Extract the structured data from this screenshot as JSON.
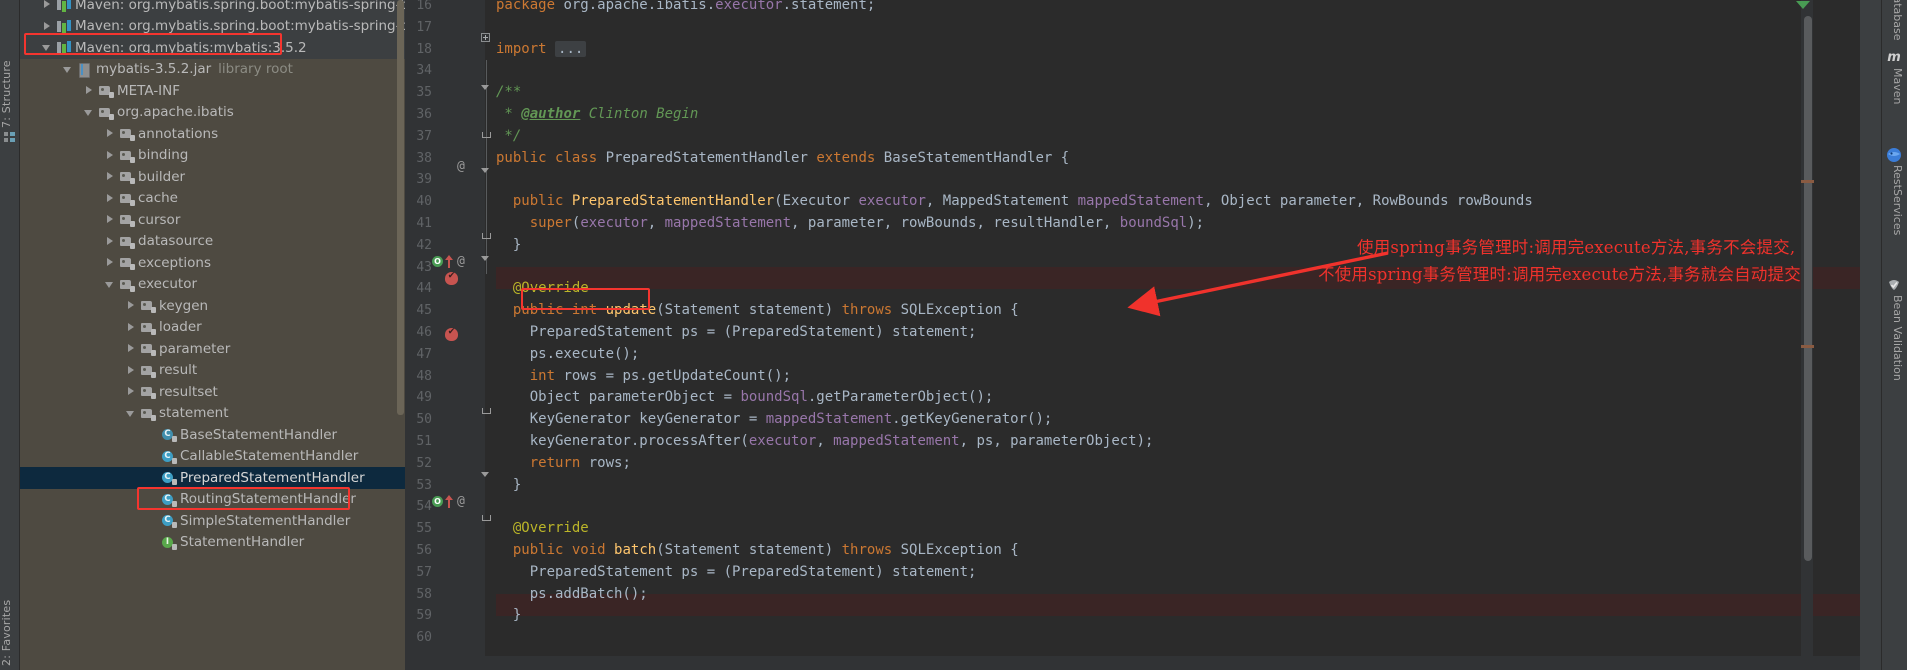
{
  "app": {
    "theme_bg": "#2b2b2b",
    "accent_red": "#f0322c",
    "selection_blue": "#0d293e"
  },
  "left_tool_strip": {
    "tabs": [
      {
        "label": "7: Structure",
        "name": "structure"
      },
      {
        "label": "2: Favorites",
        "name": "favorites"
      }
    ]
  },
  "project_tree": {
    "rows": [
      {
        "indent": 0,
        "arrow": "closed",
        "icon": "maven",
        "label": "Maven: org.mybatis.spring.boot:mybatis-spring-boot-a",
        "sub": "",
        "dark": true,
        "selected": false,
        "highlight": false
      },
      {
        "indent": 0,
        "arrow": "closed",
        "icon": "maven",
        "label": "Maven: org.mybatis.spring.boot:mybatis-spring-boot-st",
        "sub": "",
        "dark": true,
        "selected": false,
        "highlight": false
      },
      {
        "indent": 0,
        "arrow": "open",
        "icon": "maven",
        "label": "Maven: org.mybatis:mybatis:3.5.2",
        "sub": "",
        "dark": true,
        "selected": false,
        "highlight": true
      },
      {
        "indent": 1,
        "arrow": "open",
        "icon": "jar",
        "label": "mybatis-3.5.2.jar",
        "sub": "library root",
        "dark": false,
        "selected": false,
        "highlight": false
      },
      {
        "indent": 2,
        "arrow": "closed",
        "icon": "pkg",
        "label": "META-INF",
        "sub": "",
        "dark": false,
        "selected": false,
        "highlight": false
      },
      {
        "indent": 2,
        "arrow": "open",
        "icon": "pkg",
        "label": "org.apache.ibatis",
        "sub": "",
        "dark": false,
        "selected": false,
        "highlight": false
      },
      {
        "indent": 3,
        "arrow": "closed",
        "icon": "pkg",
        "label": "annotations",
        "sub": "",
        "dark": false,
        "selected": false,
        "highlight": false
      },
      {
        "indent": 3,
        "arrow": "closed",
        "icon": "pkg",
        "label": "binding",
        "sub": "",
        "dark": false,
        "selected": false,
        "highlight": false
      },
      {
        "indent": 3,
        "arrow": "closed",
        "icon": "pkg",
        "label": "builder",
        "sub": "",
        "dark": false,
        "selected": false,
        "highlight": false
      },
      {
        "indent": 3,
        "arrow": "closed",
        "icon": "pkg",
        "label": "cache",
        "sub": "",
        "dark": false,
        "selected": false,
        "highlight": false
      },
      {
        "indent": 3,
        "arrow": "closed",
        "icon": "pkg",
        "label": "cursor",
        "sub": "",
        "dark": false,
        "selected": false,
        "highlight": false
      },
      {
        "indent": 3,
        "arrow": "closed",
        "icon": "pkg",
        "label": "datasource",
        "sub": "",
        "dark": false,
        "selected": false,
        "highlight": false
      },
      {
        "indent": 3,
        "arrow": "closed",
        "icon": "pkg",
        "label": "exceptions",
        "sub": "",
        "dark": false,
        "selected": false,
        "highlight": false
      },
      {
        "indent": 3,
        "arrow": "open",
        "icon": "pkg",
        "label": "executor",
        "sub": "",
        "dark": false,
        "selected": false,
        "highlight": false
      },
      {
        "indent": 4,
        "arrow": "closed",
        "icon": "pkg",
        "label": "keygen",
        "sub": "",
        "dark": false,
        "selected": false,
        "highlight": false
      },
      {
        "indent": 4,
        "arrow": "closed",
        "icon": "pkg",
        "label": "loader",
        "sub": "",
        "dark": false,
        "selected": false,
        "highlight": false
      },
      {
        "indent": 4,
        "arrow": "closed",
        "icon": "pkg",
        "label": "parameter",
        "sub": "",
        "dark": false,
        "selected": false,
        "highlight": false
      },
      {
        "indent": 4,
        "arrow": "closed",
        "icon": "pkg",
        "label": "result",
        "sub": "",
        "dark": false,
        "selected": false,
        "highlight": false
      },
      {
        "indent": 4,
        "arrow": "closed",
        "icon": "pkg",
        "label": "resultset",
        "sub": "",
        "dark": false,
        "selected": false,
        "highlight": false
      },
      {
        "indent": 4,
        "arrow": "open",
        "icon": "pkg",
        "label": "statement",
        "sub": "",
        "dark": false,
        "selected": false,
        "highlight": false
      },
      {
        "indent": 5,
        "arrow": "none",
        "icon": "cls-abstract",
        "label": "BaseStatementHandler",
        "sub": "",
        "dark": false,
        "selected": false,
        "highlight": false
      },
      {
        "indent": 5,
        "arrow": "none",
        "icon": "cls",
        "label": "CallableStatementHandler",
        "sub": "",
        "dark": false,
        "selected": false,
        "highlight": false
      },
      {
        "indent": 5,
        "arrow": "none",
        "icon": "cls",
        "label": "PreparedStatementHandler",
        "sub": "",
        "dark": false,
        "selected": true,
        "highlight": true
      },
      {
        "indent": 5,
        "arrow": "none",
        "icon": "cls",
        "label": "RoutingStatementHandler",
        "sub": "",
        "dark": false,
        "selected": false,
        "highlight": false
      },
      {
        "indent": 5,
        "arrow": "none",
        "icon": "cls",
        "label": "SimpleStatementHandler",
        "sub": "",
        "dark": false,
        "selected": false,
        "highlight": false
      },
      {
        "indent": 5,
        "arrow": "none",
        "icon": "iface",
        "label": "StatementHandler",
        "sub": "",
        "dark": false,
        "selected": false,
        "highlight": false
      }
    ]
  },
  "editor": {
    "line_numbers": [
      "16",
      "17",
      "18",
      "34",
      "35",
      "36",
      "37",
      "38",
      "39",
      "40",
      "41",
      "42",
      "43",
      "44",
      "45",
      "46",
      "47",
      "48",
      "49",
      "50",
      "51",
      "52",
      "53",
      "54",
      "55",
      "56",
      "57",
      "58",
      "59",
      "60"
    ],
    "gutter_markers": [
      {
        "line": "40",
        "type": "at",
        "glyph": "@"
      },
      {
        "line": "45",
        "type": "override-up",
        "glyph": "@"
      },
      {
        "line": "46",
        "type": "bookmark"
      },
      {
        "line": "49",
        "type": "bookmark"
      },
      {
        "line": "56",
        "type": "override-up",
        "glyph": "@"
      }
    ],
    "code_lines": [
      {
        "n": "16",
        "text": "package org.apache.ibatis.executor.statement;"
      },
      {
        "n": "17",
        "text": ""
      },
      {
        "n": "18",
        "text": "import ..."
      },
      {
        "n": "34",
        "text": ""
      },
      {
        "n": "35",
        "text": "/**"
      },
      {
        "n": "36",
        "text": " * @author Clinton Begin"
      },
      {
        "n": "37",
        "text": " */"
      },
      {
        "n": "38",
        "text": "public class PreparedStatementHandler extends BaseStatementHandler {"
      },
      {
        "n": "39",
        "text": ""
      },
      {
        "n": "40",
        "text": "  public PreparedStatementHandler(Executor executor, MappedStatement mappedStatement, Object parameter, RowBounds rowBounds"
      },
      {
        "n": "41",
        "text": "    super(executor, mappedStatement, parameter, rowBounds, resultHandler, boundSql);"
      },
      {
        "n": "42",
        "text": "  }"
      },
      {
        "n": "43",
        "text": ""
      },
      {
        "n": "44",
        "text": "  @Override"
      },
      {
        "n": "45",
        "text": "  public int update(Statement statement) throws SQLException {"
      },
      {
        "n": "46",
        "text": "    PreparedStatement ps = (PreparedStatement) statement;"
      },
      {
        "n": "47",
        "text": "    ps.execute();"
      },
      {
        "n": "48",
        "text": "    int rows = ps.getUpdateCount();"
      },
      {
        "n": "49",
        "text": "    Object parameterObject = boundSql.getParameterObject();"
      },
      {
        "n": "50",
        "text": "    KeyGenerator keyGenerator = mappedStatement.getKeyGenerator();"
      },
      {
        "n": "51",
        "text": "    keyGenerator.processAfter(executor, mappedStatement, ps, parameterObject);"
      },
      {
        "n": "52",
        "text": "    return rows;"
      },
      {
        "n": "53",
        "text": "  }"
      },
      {
        "n": "54",
        "text": ""
      },
      {
        "n": "55",
        "text": "  @Override"
      },
      {
        "n": "56",
        "text": "  public void batch(Statement statement) throws SQLException {"
      },
      {
        "n": "57",
        "text": "    PreparedStatement ps = (PreparedStatement) statement;"
      },
      {
        "n": "58",
        "text": "    ps.addBatch();"
      },
      {
        "n": "59",
        "text": "  }"
      },
      {
        "n": "60",
        "text": ""
      }
    ],
    "annotations": {
      "line1": "使用spring事务管理时:调用完execute方法,事务不会提交,",
      "line2": "不使用spring事务管理时:调用完execute方法,事务就会自动提交",
      "color": "#f0322c"
    },
    "highlighted_code": "ps.execute();"
  },
  "right_tool_strip": {
    "tabs": [
      {
        "label": "Database",
        "icon": "database-icon"
      },
      {
        "label": "Maven",
        "icon": "maven-m-icon"
      },
      {
        "label": "RestServices",
        "icon": "rest-services-icon"
      },
      {
        "label": "Bean Validation",
        "icon": "bean-validation-icon"
      }
    ]
  }
}
